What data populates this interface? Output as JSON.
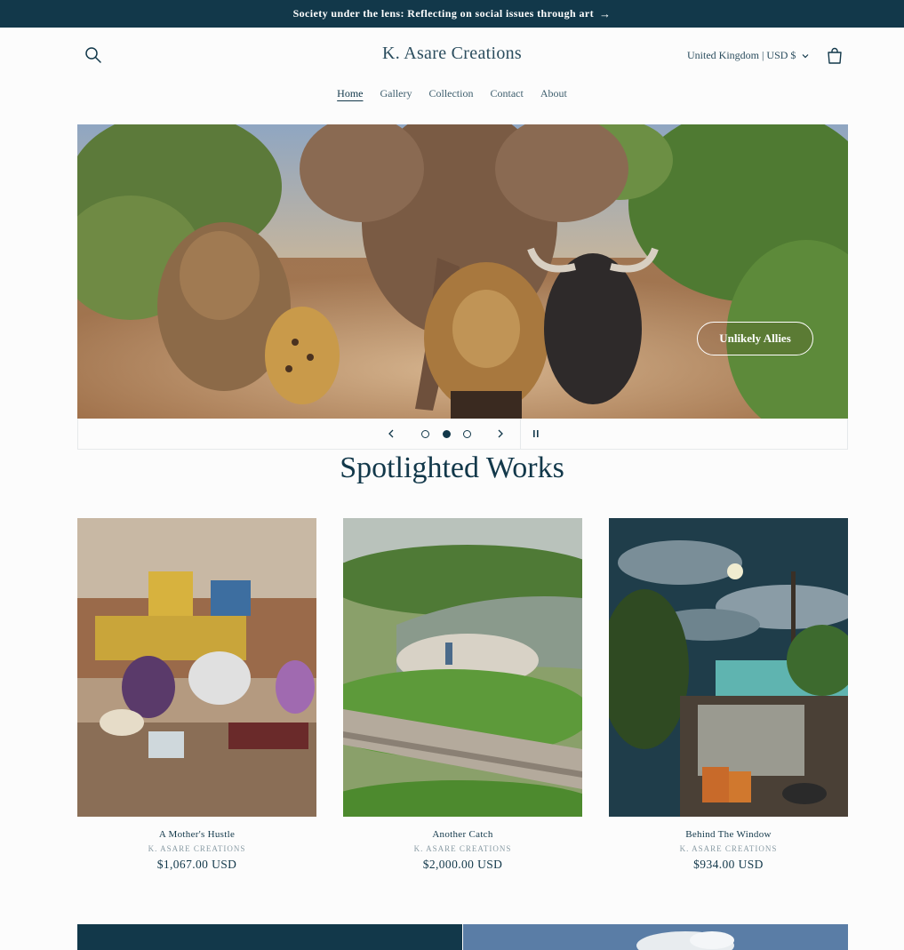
{
  "announcement": {
    "text": "Society under the lens: Reflecting on social issues through art",
    "arrow": "→"
  },
  "header": {
    "logo": "K. Asare Creations",
    "country_selector": "United Kingdom | USD $"
  },
  "nav": {
    "items": [
      {
        "label": "Home"
      },
      {
        "label": "Gallery"
      },
      {
        "label": "Collection"
      },
      {
        "label": "Contact"
      },
      {
        "label": "About"
      }
    ]
  },
  "hero": {
    "button_label": "Unlikely Allies",
    "slide_count": 3,
    "active_slide": 2
  },
  "section": {
    "title": "Spotlighted Works"
  },
  "products": [
    {
      "title": "A Mother's Hustle",
      "vendor": "K. ASARE CREATIONS",
      "price": "$1,067.00 USD"
    },
    {
      "title": "Another Catch",
      "vendor": "K. ASARE CREATIONS",
      "price": "$2,000.00 USD"
    },
    {
      "title": "Behind The Window",
      "vendor": "K. ASARE CREATIONS",
      "price": "$934.00 USD"
    }
  ],
  "colors": {
    "brand": "#12384a",
    "background": "#fcfcfc"
  }
}
